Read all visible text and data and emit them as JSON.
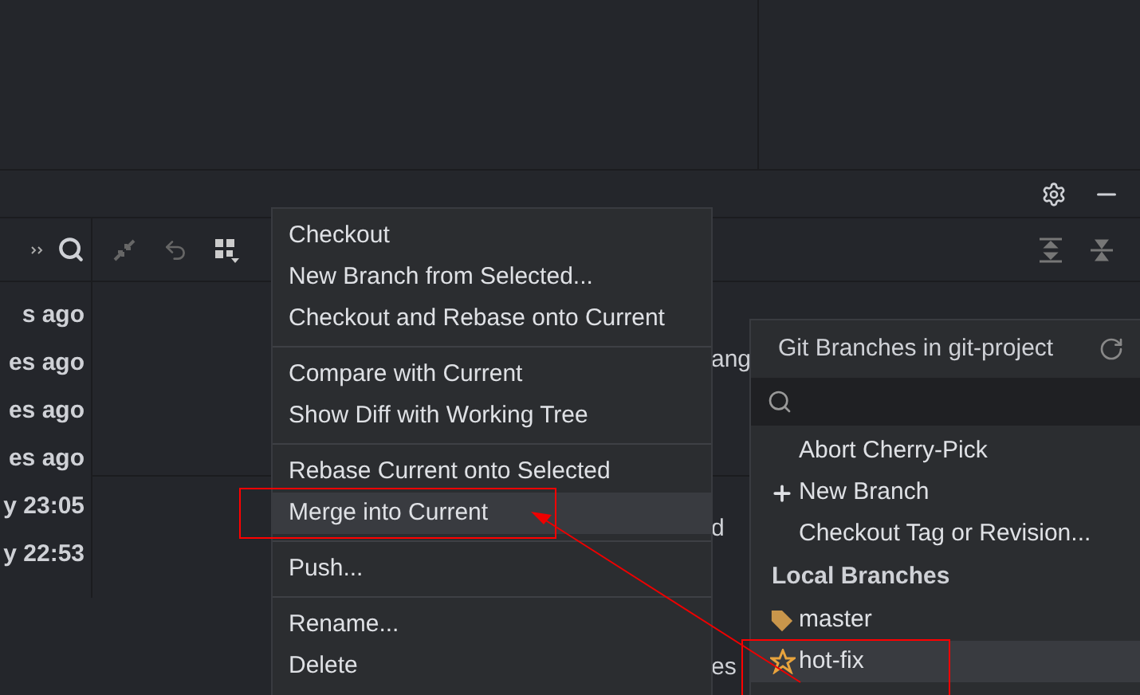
{
  "log_panel": {
    "dates": [
      "s ago",
      "es ago",
      "es ago",
      "es ago",
      "y 23:05",
      "y 22:53"
    ],
    "partial_texts": [
      "ang",
      "d",
      "es"
    ]
  },
  "context_menu": {
    "groups": [
      [
        {
          "label": "Checkout",
          "selected": false
        },
        {
          "label": "New Branch from Selected...",
          "selected": false
        },
        {
          "label": "Checkout and Rebase onto Current",
          "selected": false
        }
      ],
      [
        {
          "label": "Compare with Current",
          "selected": false
        },
        {
          "label": "Show Diff with Working Tree",
          "selected": false
        }
      ],
      [
        {
          "label": "Rebase Current onto Selected",
          "selected": false
        },
        {
          "label": "Merge into Current",
          "selected": true
        }
      ],
      [
        {
          "label": "Push...",
          "selected": false
        }
      ],
      [
        {
          "label": "Rename...",
          "selected": false
        },
        {
          "label": "Delete",
          "selected": false
        }
      ]
    ]
  },
  "branches_popup": {
    "title": "Git Branches in git-project",
    "actions": [
      {
        "label": "Abort Cherry-Pick",
        "kind": "plain"
      },
      {
        "label": "New Branch",
        "kind": "add"
      },
      {
        "label": "Checkout Tag or Revision...",
        "kind": "plain"
      }
    ],
    "section": "Local Branches",
    "branches": [
      {
        "name": "master",
        "kind": "tag",
        "selected": false
      },
      {
        "name": "hot-fix",
        "kind": "star",
        "selected": true
      }
    ]
  }
}
